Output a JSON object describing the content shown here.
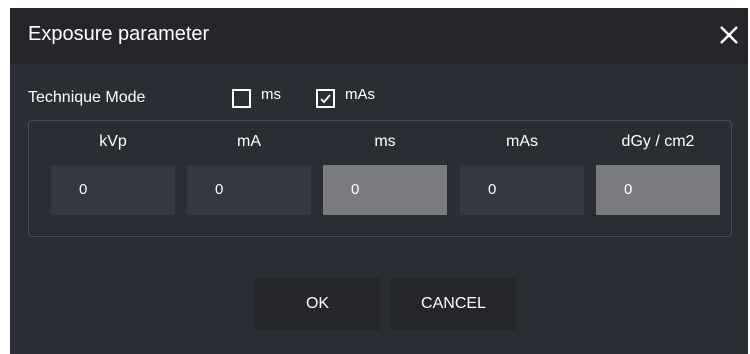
{
  "dialog": {
    "title": "Exposure parameter",
    "close_icon": "close-icon"
  },
  "technique": {
    "label": "Technique Mode",
    "options": [
      {
        "label": "ms",
        "checked": false
      },
      {
        "label": "mAs",
        "checked": true
      }
    ]
  },
  "params": [
    {
      "header": "kVp",
      "value": "0",
      "readonly": false
    },
    {
      "header": "mA",
      "value": "0",
      "readonly": false
    },
    {
      "header": "ms",
      "value": "0",
      "readonly": true
    },
    {
      "header": "mAs",
      "value": "0",
      "readonly": false
    },
    {
      "header": "dGy / cm2",
      "value": "0",
      "readonly": true
    }
  ],
  "buttons": {
    "ok": "OK",
    "cancel": "CANCEL"
  },
  "colors": {
    "dialog_bg": "#2b2d35",
    "title_bg": "#24262c",
    "field_bg": "#353840",
    "readonly_field_bg": "#7a7b80",
    "text": "#ffffff"
  }
}
